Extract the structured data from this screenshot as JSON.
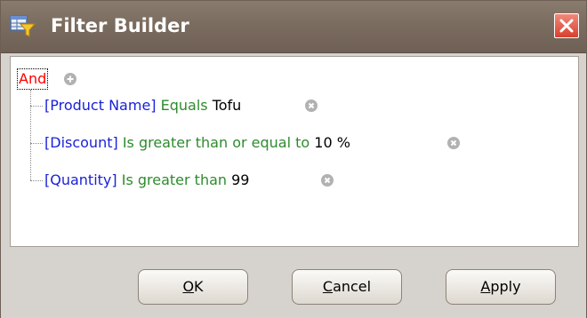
{
  "window": {
    "title": "Filter Builder"
  },
  "tree": {
    "group_operator": "And",
    "conditions": [
      {
        "field": "[Product Name]",
        "operator": "Equals",
        "value": "Tofu"
      },
      {
        "field": "[Discount]",
        "operator": "Is greater than or equal to",
        "value": "10 %"
      },
      {
        "field": "[Quantity]",
        "operator": "Is greater than",
        "value": "99"
      }
    ]
  },
  "buttons": {
    "ok": {
      "hotkey": "O",
      "rest": "K"
    },
    "cancel": {
      "hotkey": "C",
      "rest": "ancel"
    },
    "apply": {
      "hotkey": "A",
      "rest": "pply"
    }
  },
  "colors": {
    "field": "#1a22d8",
    "operator": "#2e8b2e",
    "group_operator": "#ff0000",
    "titlebar": "#7b6c60"
  }
}
